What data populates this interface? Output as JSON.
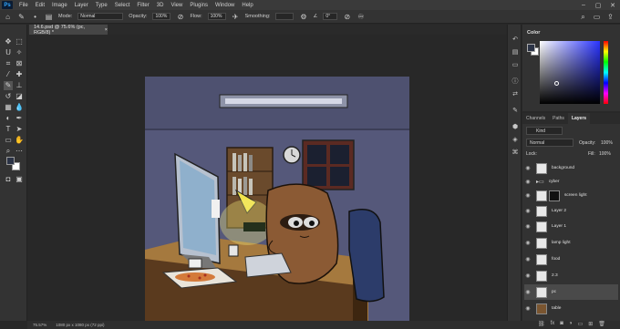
{
  "menubar": {
    "logo": "Ps",
    "items": [
      "File",
      "Edit",
      "Image",
      "Layer",
      "Type",
      "Select",
      "Filter",
      "3D",
      "View",
      "Plugins",
      "Window",
      "Help"
    ],
    "window_controls": [
      "–",
      "▢",
      "✕"
    ]
  },
  "options": {
    "mode_label": "Mode:",
    "mode_value": "Normal",
    "opacity_label": "Opacity:",
    "opacity_value": "100%",
    "flow_label": "Flow:",
    "flow_value": "100%",
    "smoothing_label": "Smoothing:",
    "angle_value": "0°"
  },
  "document": {
    "tab_title": "14.6.psd @ 75.6% (pc, RGB/8) *",
    "close_glyph": "×"
  },
  "colors": {
    "foreground": "#2b3346",
    "background": "#ffffff",
    "accent": "#2a34ff"
  },
  "color_panel": {
    "title": "Color"
  },
  "layers_panel": {
    "tabs": [
      "Channels",
      "Paths",
      "Layers"
    ],
    "kind_label": "Kind",
    "blend_mode": "Normal",
    "opacity_label": "Opacity:",
    "opacity_value": "100%",
    "lock_label": "Lock:",
    "fill_label": "Fill:",
    "fill_value": "100%",
    "layers": [
      {
        "name": "background",
        "visible": true,
        "selected": false
      },
      {
        "name": "cyber",
        "visible": true,
        "selected": false,
        "group": true
      },
      {
        "name": "screen light",
        "visible": true,
        "selected": false,
        "mask": true
      },
      {
        "name": "Layer 2",
        "visible": true,
        "selected": false
      },
      {
        "name": "Layer 1",
        "visible": true,
        "selected": false
      },
      {
        "name": "lamp light",
        "visible": true,
        "selected": false
      },
      {
        "name": "food",
        "visible": true,
        "selected": false
      },
      {
        "name": "2.3",
        "visible": true,
        "selected": false
      },
      {
        "name": "pc",
        "visible": true,
        "selected": true
      },
      {
        "name": "table",
        "visible": true,
        "selected": false
      }
    ]
  },
  "status": {
    "zoom": "75.57%",
    "doc_info": "1080 px x 1080 px (72 ppi)"
  }
}
